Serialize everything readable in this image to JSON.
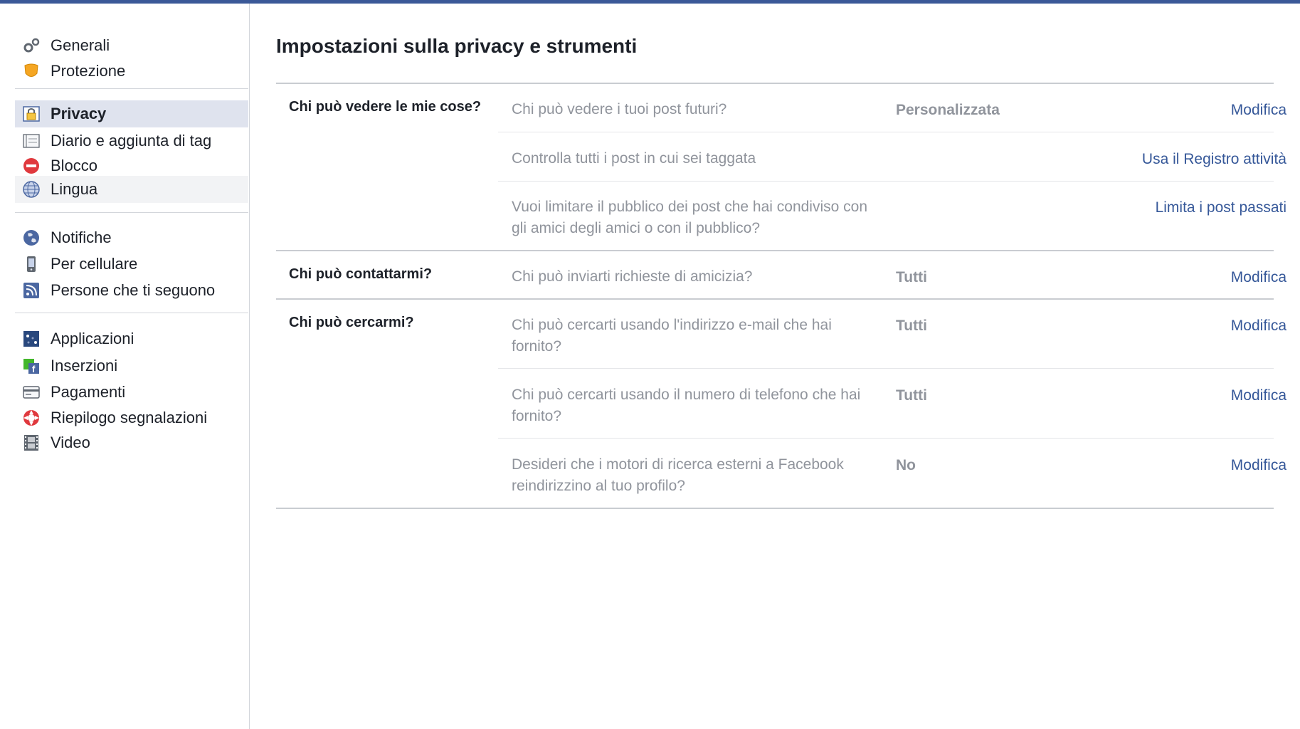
{
  "sidebar": {
    "group1": [
      {
        "label": "Generali",
        "icon": "gears-icon"
      },
      {
        "label": "Protezione",
        "icon": "shield-icon"
      }
    ],
    "group2": [
      {
        "label": "Privacy",
        "icon": "lock-icon"
      },
      {
        "label": "Diario e aggiunta di tag",
        "icon": "timeline-icon"
      },
      {
        "label": "Blocco",
        "icon": "block-icon"
      },
      {
        "label": "Lingua",
        "icon": "globe-icon"
      }
    ],
    "group3": [
      {
        "label": "Notifiche",
        "icon": "globe-notification-icon"
      },
      {
        "label": "Per cellulare",
        "icon": "mobile-icon"
      },
      {
        "label": "Persone che ti seguono",
        "icon": "rss-icon"
      }
    ],
    "group4": [
      {
        "label": "Applicazioni",
        "icon": "apps-icon"
      },
      {
        "label": "Inserzioni",
        "icon": "ads-icon"
      },
      {
        "label": "Pagamenti",
        "icon": "card-icon"
      },
      {
        "label": "Riepilogo segnalazioni",
        "icon": "lifebuoy-icon"
      },
      {
        "label": "Video",
        "icon": "film-icon"
      }
    ]
  },
  "main": {
    "title": "Impostazioni sulla privacy e strumenti",
    "sections": [
      {
        "label": "Chi può vedere le mie cose?",
        "rows": [
          {
            "question": "Chi può vedere i tuoi post futuri?",
            "value": "Personalizzata",
            "action": "Modifica"
          },
          {
            "question": "Controlla tutti i post in cui sei taggata",
            "value": "",
            "action": "Usa il Registro attività"
          },
          {
            "question": "Vuoi limitare il pubblico dei post che hai condiviso con gli amici degli amici o con il pubblico?",
            "value": "",
            "action": "Limita i post passati"
          }
        ]
      },
      {
        "label": "Chi può contattarmi?",
        "rows": [
          {
            "question": "Chi può inviarti richieste di amicizia?",
            "value": "Tutti",
            "action": "Modifica"
          }
        ]
      },
      {
        "label": "Chi può cercarmi?",
        "rows": [
          {
            "question": "Chi può cercarti usando l'indirizzo e-mail che hai fornito?",
            "value": "Tutti",
            "action": "Modifica"
          },
          {
            "question": "Chi può cercarti usando il numero di telefono che hai fornito?",
            "value": "Tutti",
            "action": "Modifica"
          },
          {
            "question": "Desideri che i motori di ricerca esterni a Facebook reindirizzino al tuo profilo?",
            "value": "No",
            "action": "Modifica"
          }
        ]
      }
    ]
  },
  "colors": {
    "accent": "#3b5998",
    "link": "#365899",
    "muted": "#90949c",
    "active_bg": "#dfe3ee"
  }
}
